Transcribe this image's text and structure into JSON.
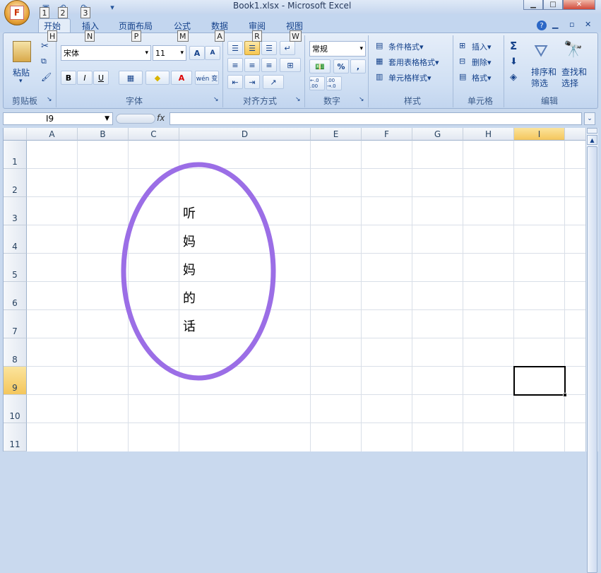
{
  "titlebar": {
    "title": "Book1.xlsx - Microsoft Excel",
    "orb_letter": "F",
    "qat_keytips": [
      "1",
      "2",
      "3"
    ]
  },
  "tabs": [
    {
      "label": "开始",
      "keytip": "H"
    },
    {
      "label": "插入",
      "keytip": "N"
    },
    {
      "label": "页面布局",
      "keytip": "P"
    },
    {
      "label": "公式",
      "keytip": "M"
    },
    {
      "label": "数据",
      "keytip": "A"
    },
    {
      "label": "审阅",
      "keytip": "R"
    },
    {
      "label": "视图",
      "keytip": "W"
    }
  ],
  "ribbon": {
    "clipboard": {
      "paste": "粘贴",
      "label": "剪贴板"
    },
    "font": {
      "name": "宋体",
      "size": "11",
      "bold": "B",
      "italic": "I",
      "underline": "U",
      "grow": "A",
      "shrink": "A",
      "color_a": "A",
      "wen": "wén 变",
      "label": "字体"
    },
    "alignment": {
      "label": "对齐方式"
    },
    "number": {
      "format": "常规",
      "percent": "%",
      "comma": ",",
      "inc": "←.0 .00",
      "dec": ".00 →.0",
      "label": "数字"
    },
    "styles": {
      "cond": "条件格式",
      "table": "套用表格格式",
      "cell": "单元格样式",
      "label": "样式"
    },
    "cells": {
      "insert": "插入",
      "delete": "删除",
      "format": "格式",
      "label": "单元格"
    },
    "editing": {
      "sigma": "Σ",
      "sort": "排序和\n筛选",
      "find": "查找和\n选择",
      "label": "编辑"
    }
  },
  "formula": {
    "namebox": "I9",
    "fx": "fx",
    "value": ""
  },
  "sheet": {
    "columns": [
      "A",
      "B",
      "C",
      "D",
      "E",
      "F",
      "G",
      "H",
      "I"
    ],
    "rows": [
      "1",
      "2",
      "3",
      "4",
      "5",
      "6",
      "7",
      "8",
      "9",
      "10",
      "11"
    ],
    "selected_cell": "I9",
    "cells": [
      {
        "ref": "C3",
        "text": "听"
      },
      {
        "ref": "C4",
        "text": "妈"
      },
      {
        "ref": "C5",
        "text": "妈"
      },
      {
        "ref": "C6",
        "text": "的"
      },
      {
        "ref": "C7",
        "text": "话"
      }
    ],
    "shape_color": "#9b6ee6"
  },
  "colors": {
    "accent": "#15428b",
    "selection": "#f4c65c"
  }
}
